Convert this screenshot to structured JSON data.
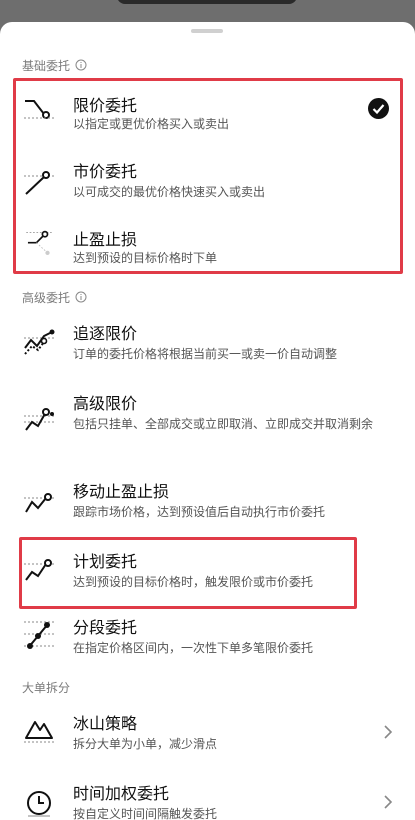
{
  "basic_section": {
    "title": "基础委托",
    "items": [
      {
        "title": "限价委托",
        "desc": "以指定或更优价格买入或卖出",
        "selected": true
      },
      {
        "title": "市价委托",
        "desc": "以可成交的最优价格快速买入或卖出"
      },
      {
        "title": "止盈止损",
        "desc": "达到预设的目标价格时下单"
      }
    ]
  },
  "advanced_section": {
    "title": "高级委托",
    "items": [
      {
        "title": "追逐限价",
        "desc": "订单的委托价格将根据当前买一或卖一价自动调整"
      },
      {
        "title": "高级限价",
        "desc": "包括只挂单、全部成交或立即取消、立即成交并取消剩余"
      },
      {
        "title": "移动止盈止损",
        "desc": "跟踪市场价格，达到预设值后自动执行市价委托"
      },
      {
        "title": "计划委托",
        "desc": "达到预设的目标价格时，触发限价或市价委托"
      },
      {
        "title": "分段委托",
        "desc": "在指定价格区间内，一次性下单多笔限价委托"
      }
    ]
  },
  "split_section": {
    "title": "大单拆分",
    "items": [
      {
        "title": "冰山策略",
        "desc": "拆分大单为小单，减少滑点"
      },
      {
        "title": "时间加权委托",
        "desc": "按自定义时间间隔触发委托"
      }
    ]
  },
  "colors": {
    "highlight": "#e03b47",
    "text_primary": "#111111",
    "text_secondary": "#555555"
  }
}
